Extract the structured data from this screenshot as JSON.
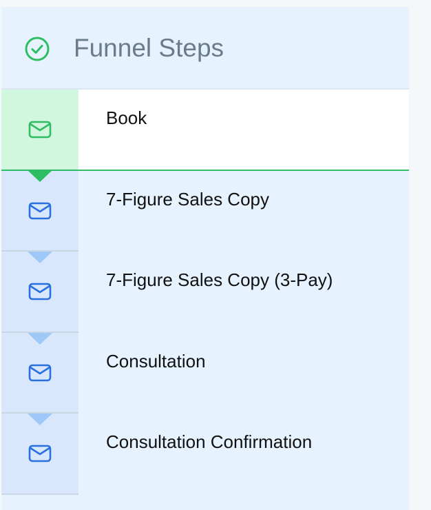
{
  "header": {
    "title": "Funnel Steps",
    "icon": "check-circle-icon",
    "icon_color": "#2ebd62"
  },
  "steps": [
    {
      "label": "Book",
      "icon": "mail-icon",
      "active": true
    },
    {
      "label": "7-Figure Sales Copy",
      "icon": "mail-icon",
      "active": false
    },
    {
      "label": "7-Figure Sales Copy (3-Pay)",
      "icon": "mail-icon",
      "active": false
    },
    {
      "label": "Consultation",
      "icon": "mail-icon",
      "active": false
    },
    {
      "label": "Consultation Confirmation",
      "icon": "mail-icon",
      "active": false
    }
  ],
  "colors": {
    "active_accent": "#2ebd62",
    "inactive_icon": "#2a6fe0",
    "connector": "#9dc8f7"
  }
}
